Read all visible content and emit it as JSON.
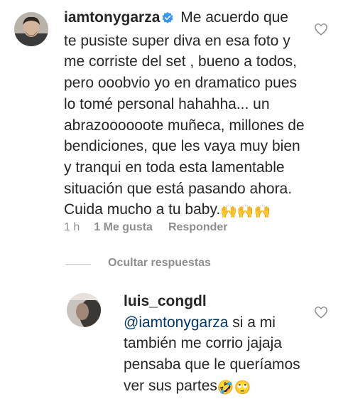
{
  "comment": {
    "username": "iamtonygarza",
    "lines": [
      "Me acuerdo que",
      "te pusiste super diva en esa foto y",
      "me corriste del set , bueno a todos,",
      "pero ooobvio yo en dramatico pues",
      "lo tomé personal hahahha... un",
      "abrazoooooote muñeca, millones de",
      "bendiciones, que les vaya muy bien",
      "y tranqui en toda esta lamentable",
      "situación que está pasando ahora.",
      "Cuida mucho a tu baby."
    ],
    "emoji": "🙌🙌🙌",
    "time": "1 h",
    "likes": "1 Me gusta",
    "reply_label": "Responder"
  },
  "thread": {
    "hide_replies_label": "Ocultar respuestas"
  },
  "reply": {
    "username": "luis_congdl",
    "mention": "@iamtonygarza",
    "lines": [
      "si a mi",
      "también me corrio jajaja",
      "pensaba que le queríamos",
      "ver sus partes"
    ],
    "emoji": "🤣🙄"
  },
  "colors": {
    "text": "#262626",
    "muted": "#8e8e8e",
    "verified_blue": "#3897f0",
    "mention_blue": "#00376b"
  }
}
